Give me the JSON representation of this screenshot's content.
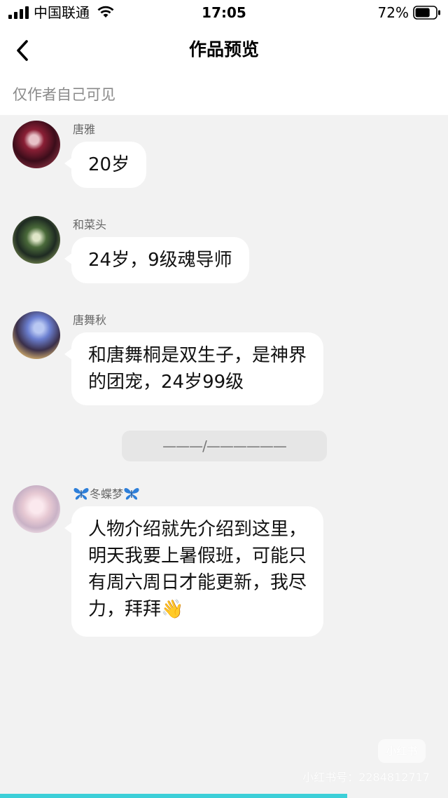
{
  "status_bar": {
    "carrier": "中国联通",
    "time": "17:05",
    "battery_percent": "72%",
    "battery_level": 0.72,
    "icons": [
      "signal-icon",
      "wifi-icon",
      "battery-icon"
    ]
  },
  "nav": {
    "back_icon": "chevron-left-icon",
    "title": "作品预览"
  },
  "notice": "仅作者自己可见",
  "messages": [
    {
      "sender": "唐雅",
      "text": "20岁",
      "avatar": "avatar-dark-red-anime"
    },
    {
      "sender": "和菜头",
      "text": "24岁，9级魂导师",
      "avatar": "avatar-armored-green"
    },
    {
      "sender": "唐舞秋",
      "text": "和唐舞桐是双生子，是神界\n的团宠，24岁99级",
      "avatar": "avatar-blue-hair-anime"
    }
  ],
  "divider": "———/——————",
  "last_message": {
    "sender_decoration_icon": "butterfly-icon",
    "sender": "冬蝶梦",
    "text": "人物介绍就先介绍到这里，\n明天我要上暑假班，可能只\n有周六周日才能更新，我尽\n力，拜拜👋",
    "avatar": "avatar-white-hair-anime"
  },
  "watermark": {
    "badge": "小红书",
    "text": "小红书号：2284812717"
  },
  "colors": {
    "background": "#f2f2f2",
    "bubble": "#ffffff",
    "progress": "#3ccfd8",
    "butterfly": "#2e7fd9"
  },
  "reading_progress": 0.775
}
